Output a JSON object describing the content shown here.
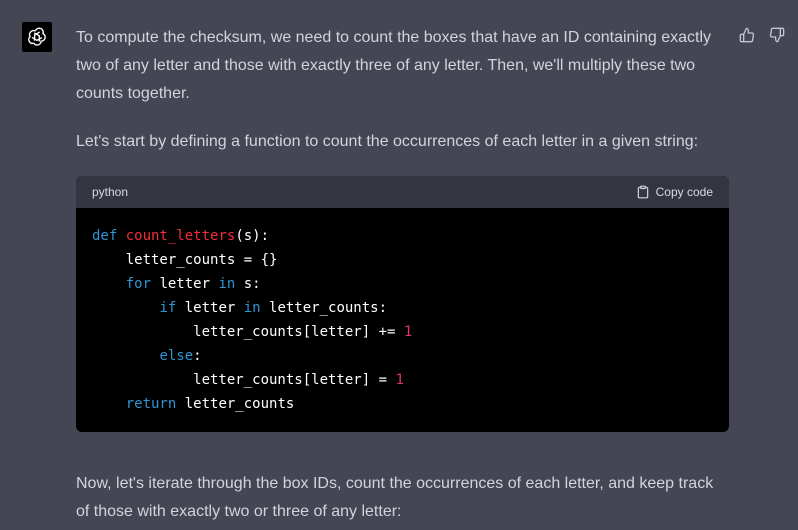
{
  "assistant": {
    "avatar_icon": "openai-logo-icon"
  },
  "feedback": {
    "thumbs_up_icon": "thumbs-up-icon",
    "thumbs_down_icon": "thumbs-down-icon"
  },
  "message": {
    "paragraph1": "To compute the checksum, we need to count the boxes that have an ID containing exactly two of any letter and those with exactly three of any letter. Then, we'll multiply these two counts together.",
    "paragraph2": "Let's start by defining a function to count the occurrences of each letter in a given string:",
    "paragraph3": "Now, let's iterate through the box IDs, count the occurrences of each letter, and keep track of those with exactly two or three of any letter:"
  },
  "code": {
    "language": "python",
    "copy_label": "Copy code",
    "lines": [
      [
        {
          "t": "def",
          "c": "kw"
        },
        {
          "t": " ",
          "c": ""
        },
        {
          "t": "count_letters",
          "c": "fn"
        },
        {
          "t": "(s):",
          "c": ""
        }
      ],
      [
        {
          "t": "    letter_counts = {}",
          "c": ""
        }
      ],
      [
        {
          "t": "    ",
          "c": ""
        },
        {
          "t": "for",
          "c": "kw"
        },
        {
          "t": " letter ",
          "c": ""
        },
        {
          "t": "in",
          "c": "kw"
        },
        {
          "t": " s:",
          "c": ""
        }
      ],
      [
        {
          "t": "        ",
          "c": ""
        },
        {
          "t": "if",
          "c": "kw"
        },
        {
          "t": " letter ",
          "c": ""
        },
        {
          "t": "in",
          "c": "kw"
        },
        {
          "t": " letter_counts:",
          "c": ""
        }
      ],
      [
        {
          "t": "            letter_counts[letter] += ",
          "c": ""
        },
        {
          "t": "1",
          "c": "num"
        }
      ],
      [
        {
          "t": "        ",
          "c": ""
        },
        {
          "t": "else",
          "c": "kw"
        },
        {
          "t": ":",
          "c": ""
        }
      ],
      [
        {
          "t": "            letter_counts[letter] = ",
          "c": ""
        },
        {
          "t": "1",
          "c": "num"
        }
      ],
      [
        {
          "t": "    ",
          "c": ""
        },
        {
          "t": "return",
          "c": "kw"
        },
        {
          "t": " letter_counts",
          "c": ""
        }
      ]
    ]
  }
}
